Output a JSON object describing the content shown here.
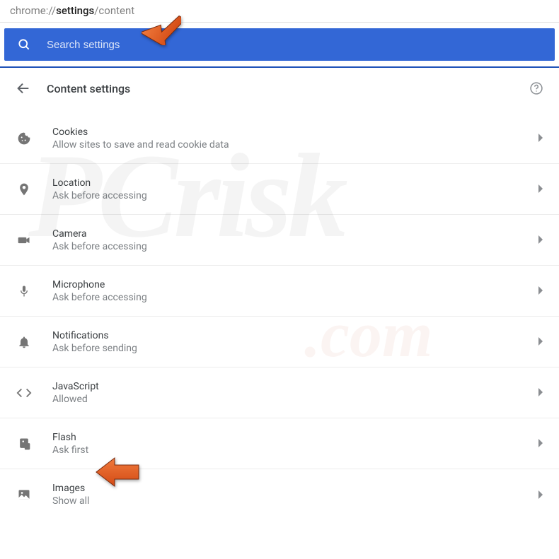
{
  "address": {
    "pre": "chrome://",
    "mid": "settings",
    "post": "/content"
  },
  "search": {
    "placeholder": "Search settings"
  },
  "header": {
    "title": "Content settings"
  },
  "items": [
    {
      "key": "cookies",
      "label": "Cookies",
      "sub": "Allow sites to save and read cookie data"
    },
    {
      "key": "location",
      "label": "Location",
      "sub": "Ask before accessing"
    },
    {
      "key": "camera",
      "label": "Camera",
      "sub": "Ask before accessing"
    },
    {
      "key": "microphone",
      "label": "Microphone",
      "sub": "Ask before accessing"
    },
    {
      "key": "notifications",
      "label": "Notifications",
      "sub": "Ask before sending"
    },
    {
      "key": "javascript",
      "label": "JavaScript",
      "sub": "Allowed"
    },
    {
      "key": "flash",
      "label": "Flash",
      "sub": "Ask first"
    },
    {
      "key": "images",
      "label": "Images",
      "sub": "Show all"
    }
  ],
  "watermark": {
    "main": "PCrisk",
    "suffix": ".com"
  }
}
